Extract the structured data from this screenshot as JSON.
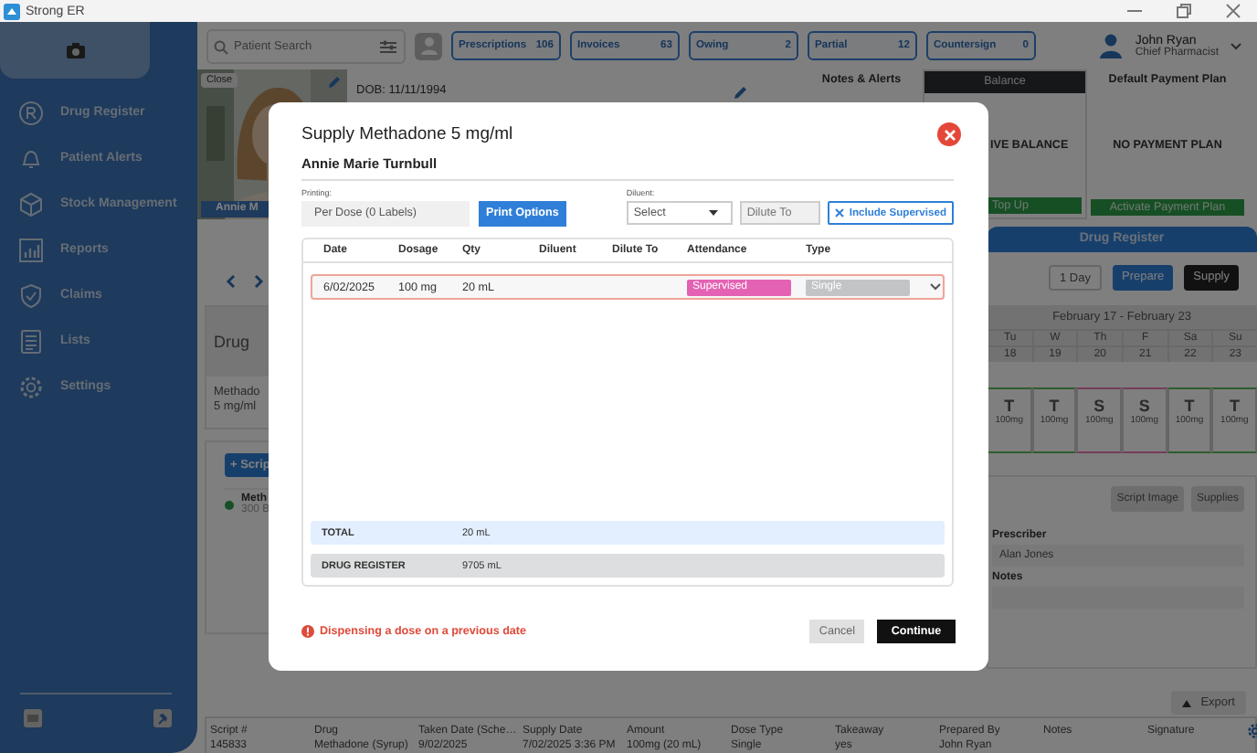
{
  "app": {
    "title": "Strong ER"
  },
  "sidebar": {
    "items": [
      {
        "label": "Drug Register"
      },
      {
        "label": "Patient Alerts"
      },
      {
        "label": "Stock Management"
      },
      {
        "label": "Reports"
      },
      {
        "label": "Claims"
      },
      {
        "label": "Lists"
      },
      {
        "label": "Settings"
      }
    ]
  },
  "topbar": {
    "search": {
      "placeholder": "Patient Search"
    },
    "counters": [
      {
        "label": "Prescriptions",
        "count": "106"
      },
      {
        "label": "Invoices",
        "count": "63"
      },
      {
        "label": "Owing",
        "count": "2"
      },
      {
        "label": "Partial",
        "count": "12"
      },
      {
        "label": "Countersign",
        "count": "0"
      }
    ],
    "user": {
      "name": "John Ryan",
      "role": "Chief Pharmacist"
    }
  },
  "patient": {
    "close_label": "Close",
    "name": "Annie M",
    "dob": "DOB: 11/11/1994"
  },
  "left": {
    "drug_header": "Drug",
    "drug_lines": [
      "Methado",
      "5 mg/ml"
    ],
    "add_button": "+ Scrip",
    "script": {
      "name": "Meth",
      "detail": "300 B"
    }
  },
  "panels": {
    "notes_title": "Notes & Alerts",
    "balance": {
      "title": "Balance",
      "value": "IVE BALANCE",
      "action": "Top Up"
    },
    "payment_plan": {
      "title": "Default Payment Plan",
      "value": "NO PAYMENT PLAN",
      "action": "Activate Payment Plan"
    }
  },
  "drug_register": {
    "title": "Drug Register",
    "buttons": [
      {
        "label": "1 Day",
        "kind": "outline"
      },
      {
        "label": "Prepare",
        "kind": "primary"
      },
      {
        "label": "Supply",
        "kind": "dark"
      }
    ],
    "calendar": {
      "range": "February 17 - February 23",
      "days": [
        {
          "day": "Tu",
          "date": "18",
          "code": "T",
          "dose": "100mg",
          "kind": "takeaway"
        },
        {
          "day": "W",
          "date": "19",
          "code": "T",
          "dose": "100mg",
          "kind": "takeaway"
        },
        {
          "day": "Th",
          "date": "20",
          "code": "S",
          "dose": "100mg",
          "kind": "supervised"
        },
        {
          "day": "F",
          "date": "21",
          "code": "S",
          "dose": "100mg",
          "kind": "supervised"
        },
        {
          "day": "Sa",
          "date": "22",
          "code": "T",
          "dose": "100mg",
          "kind": "takeaway"
        },
        {
          "day": "Su",
          "date": "23",
          "code": "T",
          "dose": "100mg",
          "kind": "takeaway"
        }
      ]
    }
  },
  "script_panel": {
    "buttons": [
      "Script Image",
      "Supplies"
    ],
    "prescriber_label": "Prescriber",
    "prescriber": "Alan Jones",
    "notes_label": "Notes"
  },
  "history": {
    "export": "Export",
    "columns": [
      "Script #",
      "Drug",
      "Taken Date (Sche…",
      "Supply Date",
      "Amount",
      "Dose Type",
      "Takeaway",
      "Prepared By",
      "Notes",
      "Signature"
    ],
    "rows": [
      [
        "145833",
        "Methadone (Syrup)",
        "9/02/2025",
        "7/02/2025 3:36 PM",
        "100mg (20 mL)",
        "Single",
        "yes",
        "John Ryan",
        "",
        ""
      ]
    ]
  },
  "modal": {
    "title": "Supply Methadone 5 mg/ml",
    "patient": "Annie Marie Turnbull",
    "printing_label": "Printing:",
    "printing_value": "Per Dose (0 Labels)",
    "print_button": "Print Options",
    "diluent_label": "Diluent:",
    "diluent_value": "Select",
    "dilute_to_placeholder": "Dilute To",
    "include_button": "Include Supervised",
    "columns": [
      "Date",
      "Dosage",
      "Qty",
      "Diluent",
      "Dilute To",
      "Attendance",
      "Type"
    ],
    "rows": [
      {
        "date": "6/02/2025",
        "dosage": "100 mg",
        "qty": "20 mL",
        "attendance": "Supervised",
        "type": "Single"
      }
    ],
    "totals": [
      {
        "label": "TOTAL",
        "value": "20 mL",
        "kind": "total"
      },
      {
        "label": "DRUG REGISTER",
        "value": "9705 mL",
        "kind": "register"
      }
    ],
    "warning": "Dispensing a dose on a previous date",
    "buttons": [
      {
        "label": "Cancel",
        "kind": "secondary"
      },
      {
        "label": "Continue",
        "kind": "primary"
      }
    ]
  }
}
